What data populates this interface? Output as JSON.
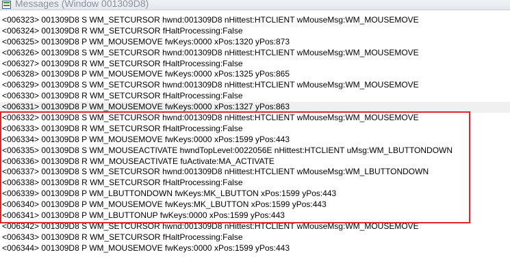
{
  "window": {
    "title": "Messages (Window 001309D8)",
    "icon": "messages-log-icon"
  },
  "messages": [
    {
      "text": "<006323> 001309D8 S WM_SETCURSOR hwnd:001309D8 nHittest:HTCLIENT wMouseMsg:WM_MOUSEMOVE"
    },
    {
      "text": "<006324> 001309D8 R WM_SETCURSOR fHaltProcessing:False"
    },
    {
      "text": "<006325> 001309D8 P WM_MOUSEMOVE fwKeys:0000 xPos:1320 yPos:873"
    },
    {
      "text": "<006326> 001309D8 S WM_SETCURSOR hwnd:001309D8 nHittest:HTCLIENT wMouseMsg:WM_MOUSEMOVE"
    },
    {
      "text": "<006327> 001309D8 R WM_SETCURSOR fHaltProcessing:False"
    },
    {
      "text": "<006328> 001309D8 P WM_MOUSEMOVE fwKeys:0000 xPos:1325 yPos:865"
    },
    {
      "text": "<006329> 001309D8 S WM_SETCURSOR hwnd:001309D8 nHittest:HTCLIENT wMouseMsg:WM_MOUSEMOVE"
    },
    {
      "text": "<006330> 001309D8 R WM_SETCURSOR fHaltProcessing:False"
    },
    {
      "text": "<006331> 001309D8 P WM_MOUSEMOVE fwKeys:0000 xPos:1327 yPos:863"
    },
    {
      "text": "<006332> 001309D8 S WM_SETCURSOR hwnd:001309D8 nHittest:HTCLIENT wMouseMsg:WM_MOUSEMOVE"
    },
    {
      "text": "<006333> 001309D8 R WM_SETCURSOR fHaltProcessing:False"
    },
    {
      "text": "<006334> 001309D8 P WM_MOUSEMOVE fwKeys:0000 xPos:1599 yPos:443"
    },
    {
      "text": "<006335> 001309D8 S WM_MOUSEACTIVATE hwndTopLevel:0022056E nHittest:HTCLIENT uMsg:WM_LBUTTONDOWN"
    },
    {
      "text": "<006336> 001309D8 R WM_MOUSEACTIVATE fuActivate:MA_ACTIVATE"
    },
    {
      "text": "<006337> 001309D8 S WM_SETCURSOR hwnd:001309D8 nHittest:HTCLIENT wMouseMsg:WM_LBUTTONDOWN"
    },
    {
      "text": "<006338> 001309D8 R WM_SETCURSOR fHaltProcessing:False"
    },
    {
      "text": "<006339> 001309D8 P WM_LBUTTONDOWN fwKeys:MK_LBUTTON xPos:1599 yPos:443"
    },
    {
      "text": "<006340> 001309D8 P WM_MOUSEMOVE fwKeys:MK_LBUTTON xPos:1599 yPos:443"
    },
    {
      "text": "<006341> 001309D8 P WM_LBUTTONUP fwKeys:0000 xPos:1599 yPos:443"
    },
    {
      "text": "<006342> 001309D8 S WM_SETCURSOR hwnd:001309D8 nHittest:HTCLIENT wMouseMsg:WM_MOUSEMOVE"
    },
    {
      "text": "<006343> 001309D8 R WM_SETCURSOR fHaltProcessing:False"
    },
    {
      "text": "<006344> 001309D8 P WM_MOUSEMOVE fwKeys:0000 xPos:1599 yPos:443"
    }
  ],
  "selected_index": 8,
  "highlight": {
    "color": "#e0242c",
    "first_index": 9,
    "last_index": 18
  }
}
